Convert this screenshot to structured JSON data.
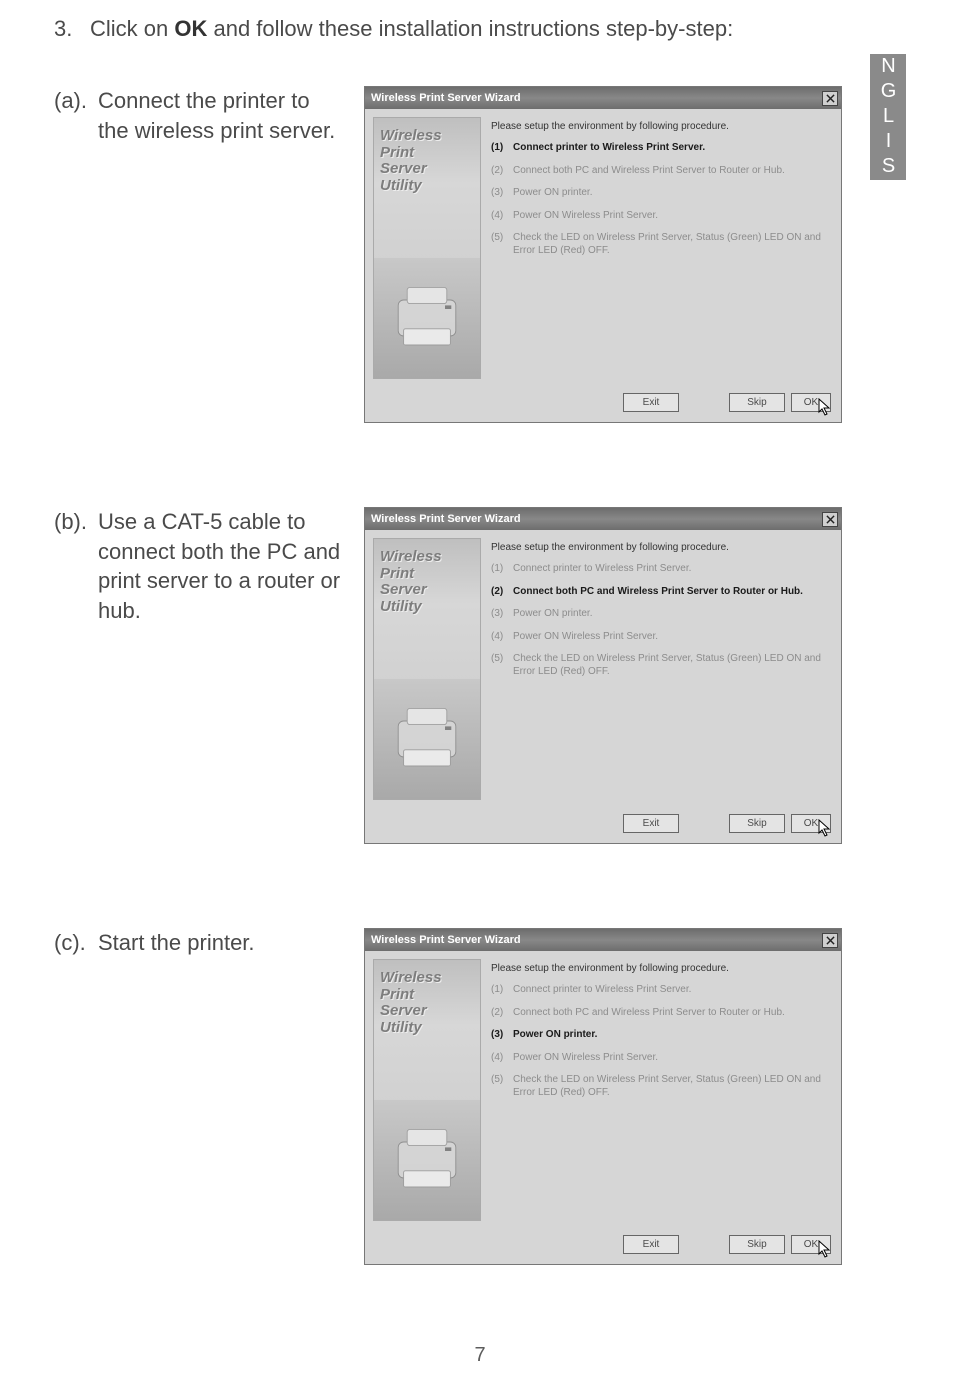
{
  "page_number": "7",
  "language_tab": "ENGLISH",
  "intro": {
    "number": "3.",
    "prefix": "Click on ",
    "ok": "OK",
    "suffix": " and follow these installation instructions step-by-step:"
  },
  "sections": [
    {
      "label": "(a).",
      "text": "Connect the printer to the wireless print server."
    },
    {
      "label": "(b).",
      "text": "Use a CAT-5 cable to connect both the PC and print server to a router or hub."
    },
    {
      "label": "(c).",
      "text": "Start the printer."
    }
  ],
  "dialog_common": {
    "title": "Wireless Print Server Wizard",
    "side_lines": [
      "Wireless",
      "Print",
      "Server",
      "Utility"
    ],
    "intro_line": "Please setup the environment by following procedure.",
    "steps": [
      {
        "n": "(1)",
        "text": "Connect printer to Wireless Print Server."
      },
      {
        "n": "(2)",
        "text": "Connect both PC and Wireless Print Server to Router or Hub."
      },
      {
        "n": "(3)",
        "text": "Power ON printer."
      },
      {
        "n": "(4)",
        "text": "Power ON Wireless Print Server."
      },
      {
        "n": "(5)",
        "text": "Check the LED on Wireless Print Server, Status (Green) LED ON and Error LED (Red) OFF."
      }
    ],
    "buttons": {
      "exit": "Exit",
      "skip": "Skip",
      "ok": "OK"
    }
  },
  "dialogs": [
    {
      "active_step": 0
    },
    {
      "active_step": 1
    },
    {
      "active_step": 2
    }
  ]
}
